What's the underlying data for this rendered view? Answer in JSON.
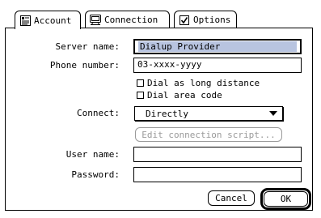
{
  "tabs": [
    {
      "label": "Account",
      "icon": "account-icon",
      "active": true
    },
    {
      "label": "Connection",
      "icon": "connection-icon",
      "active": false
    },
    {
      "label": "Options",
      "icon": "checkbox-checked-icon",
      "active": false
    }
  ],
  "form": {
    "server_name": {
      "label": "Server name:",
      "value": "Dialup Provider"
    },
    "phone_number": {
      "label": "Phone number:",
      "value": "03-xxxx-yyyy"
    },
    "dial_long_distance": {
      "label": "Dial as long distance",
      "checked": false
    },
    "dial_area_code": {
      "label": "Dial area code",
      "checked": false
    },
    "connect": {
      "label": "Connect:",
      "selected": "Directly"
    },
    "edit_script_button": "Edit connection script...",
    "user_name": {
      "label": "User name:",
      "value": ""
    },
    "password": {
      "label": "Password:",
      "value": ""
    }
  },
  "buttons": {
    "cancel": "Cancel",
    "ok": "OK"
  },
  "colors": {
    "selection_highlight": "#b8c4e0",
    "disabled_text": "#9a9a9a"
  }
}
